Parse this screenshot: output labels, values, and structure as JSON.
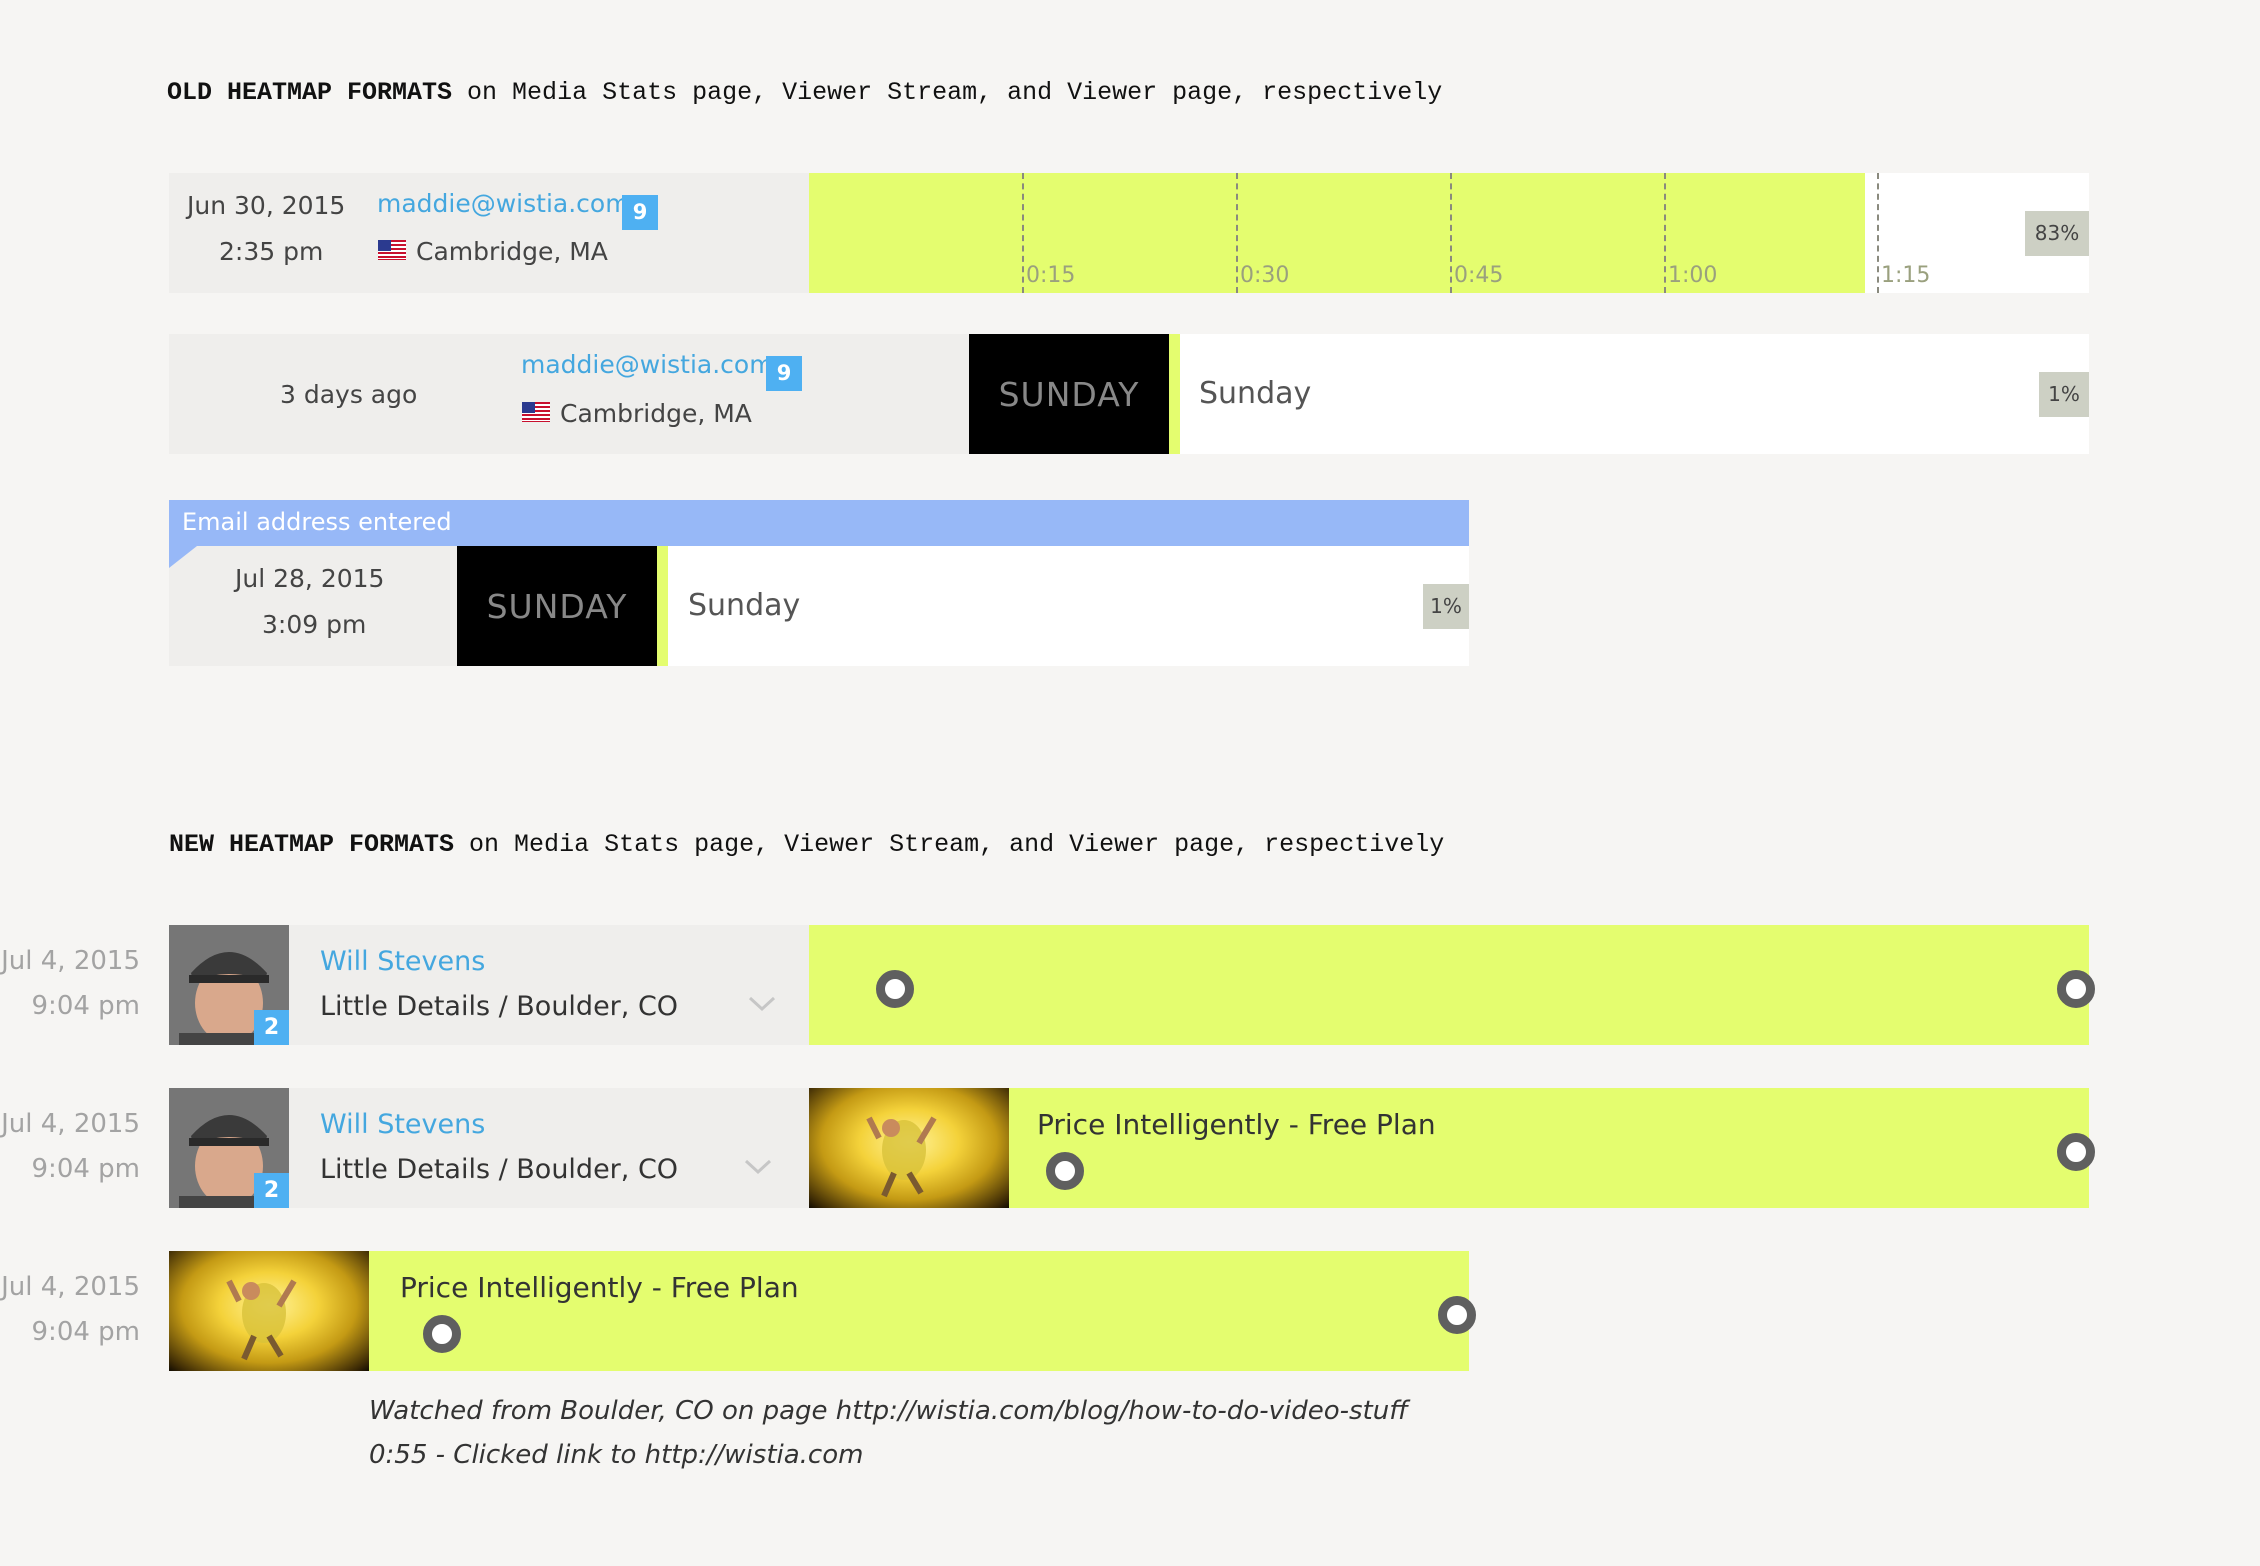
{
  "old_section": {
    "heading_bold": "OLD HEATMAP FORMATS",
    "heading_rest": " on Media Stats page, Viewer Stream, and Viewer page, respectively",
    "row1": {
      "date": "Jun 30, 2015",
      "time": "2:35 pm",
      "email": "maddie@wistia.com",
      "count": "9",
      "location": "Cambridge, MA",
      "ticks": [
        "0:15",
        "0:30",
        "0:45",
        "1:00",
        "1:15"
      ],
      "percent": "83%",
      "watched_fraction": 0.83
    },
    "row2": {
      "when": "3 days ago",
      "email": "maddie@wistia.com",
      "count": "9",
      "location": "Cambridge, MA",
      "thumb_text": "SUNDAY",
      "video_title": "Sunday",
      "percent": "1%"
    },
    "row3": {
      "banner": "Email address entered",
      "date": "Jul 28, 2015",
      "time": "3:09 pm",
      "thumb_text": "SUNDAY",
      "video_title": "Sunday",
      "percent": "1%"
    }
  },
  "new_section": {
    "heading_bold": "NEW HEATMAP FORMATS",
    "heading_rest": " on Media Stats page, Viewer Stream, and Viewer page, respectively",
    "row1": {
      "date": "Jul 4, 2015",
      "time": "9:04 pm",
      "name": "Will Stevens",
      "subtitle": "Little Details / Boulder, CO",
      "count": "2"
    },
    "row2": {
      "date": "Jul 4, 2015",
      "time": "9:04 pm",
      "name": "Will Stevens",
      "subtitle": "Little Details / Boulder, CO",
      "count": "2",
      "video_title": "Price Intelligently - Free Plan"
    },
    "row3": {
      "date": "Jul 4, 2015",
      "time": "9:04 pm",
      "video_title": "Price Intelligently - Free Plan",
      "note_line1": "Watched from Boulder, CO on page http://wistia.com/blog/how-to-do-video-stuff",
      "note_line2": "0:55 - Clicked link to http://wistia.com"
    }
  },
  "colors": {
    "lime": "#e4fd6f",
    "link_blue": "#44a7df",
    "badge_blue": "#4eb0f2",
    "banner_blue": "#97b8f7",
    "percent_gray": "#cdd0c4"
  },
  "icons": [
    "us-flag-icon",
    "chevron-down-icon",
    "marker-dot-icon"
  ]
}
